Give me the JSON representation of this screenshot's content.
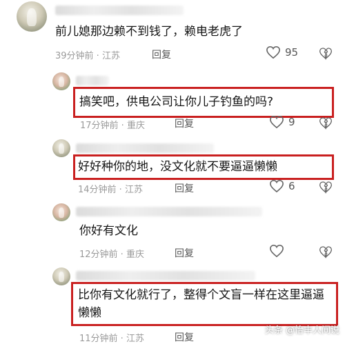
{
  "comments": [
    {
      "text": "前儿媳那边赖不到钱了，赖电老虎了",
      "meta": "39分钟前 · 江苏",
      "reply": "回复",
      "likes": "95"
    },
    {
      "text": "搞笑吧，供电公司让你儿子钓鱼的吗?",
      "meta": "17分钟前 · 重庆",
      "reply": "回复",
      "likes": "9"
    },
    {
      "text": "好好种你的地，没文化就不要逼逼懒懒",
      "meta": "14分钟前 · 江苏",
      "reply": "回复",
      "likes": "6"
    },
    {
      "text": "你好有文化",
      "meta": "12分钟前 · 重庆",
      "reply": "回复",
      "likes": ""
    },
    {
      "text": "比你有文化就行了，整得个文盲一样在这里逼逼懒懒",
      "meta": "11分钟前 · 江苏",
      "reply": "回复",
      "likes": ""
    }
  ],
  "watermark": "头条 @怡丰人间说",
  "icons": {
    "like": "heart-outline-icon",
    "dislike": "broken-heart-icon"
  },
  "colors": {
    "highlight": "#c91f1f",
    "meta": "#9a9a9a"
  }
}
